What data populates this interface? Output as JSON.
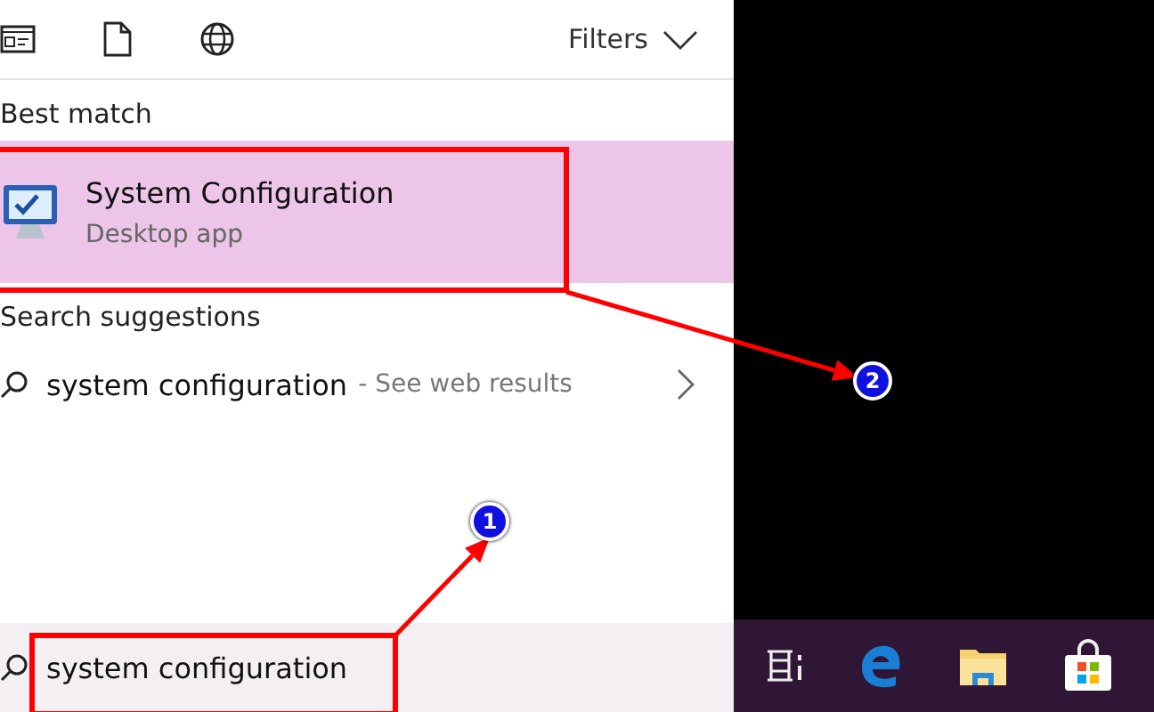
{
  "toolbar": {
    "filters_label": "Filters"
  },
  "best_match": {
    "heading": "Best match",
    "result": {
      "title": "System Configuration",
      "subtitle": "Desktop app",
      "selected": true
    }
  },
  "search_suggestions": {
    "heading": "Search suggestions",
    "items": [
      {
        "query": "system configuration",
        "hint": "- See web results"
      }
    ]
  },
  "search_box": {
    "value": "system configuration"
  },
  "annotations": [
    {
      "label": "1"
    },
    {
      "label": "2"
    }
  ]
}
